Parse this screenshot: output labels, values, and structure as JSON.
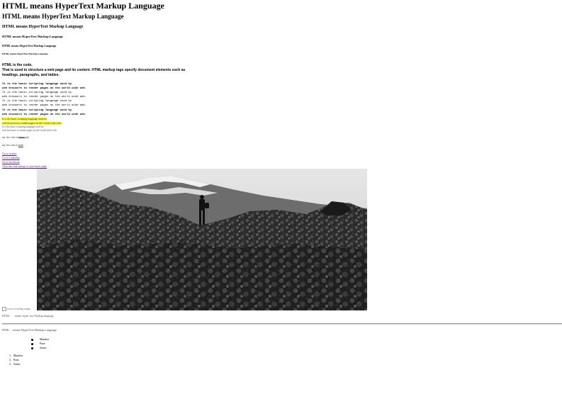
{
  "headings": {
    "h1": "HTML means HyperText Markup Language",
    "h2": "HTML means HyperText Markup Language",
    "h3": "HTML means HyperText Markup Language",
    "h4": "HTML means HyperText Markup Language",
    "h5": "HTML means HyperText Markup Language",
    "h6": "HTML means HyperText Markup Language"
  },
  "bold_block": [
    "HTML is the code,",
    "That is used to structure a web page and its content. HTML markup tags specify document elements such as",
    "headings, paragraphs, and tables."
  ],
  "code_lines": [
    "It is the basic scripting language used by",
    "web browsers to render pages on the world wide web.",
    "It is the basic scripting language used by",
    "web browsers to render pages on the world wide web.",
    "It is the basic scripting language used by",
    "web browsers to render pages on the world wide web.",
    "It is the basic scripting language used by",
    "web browsers to render pages on the world wide web."
  ],
  "highlight_lines": [
    "It is the basic scripting language used by",
    "web browsers to render pages on the world wide web."
  ],
  "small_lines": [
    "It is the basic scripting language used by",
    "web browsers to render pages on the world wide web."
  ],
  "strike_line": {
    "prefix": "my fav color is ",
    "struck": "black",
    "suffix": "pink"
  },
  "ins_line": {
    "prefix": "my fav color is ",
    "inserted": "pink"
  },
  "links": [
    "Go to twitter",
    "Go to LinkedIn",
    "Go to facebook",
    "click this link and go to java basic page"
  ],
  "image_alt": "screen loading image",
  "abbr_line": {
    "abbr": "HTML",
    "text": "means hyper text Markup language"
  },
  "term_line": {
    "abbr": "HTML",
    "text": "means HyperText Markup Language"
  },
  "unordered_list": [
    "Mumbai",
    "Pune",
    "Satara"
  ],
  "ordered_list": [
    "Mumbai",
    "Pune",
    "Satara"
  ],
  "colors": {
    "highlight": "#ffff00",
    "link": "#551a8b",
    "rule": "#9a9a9a"
  }
}
